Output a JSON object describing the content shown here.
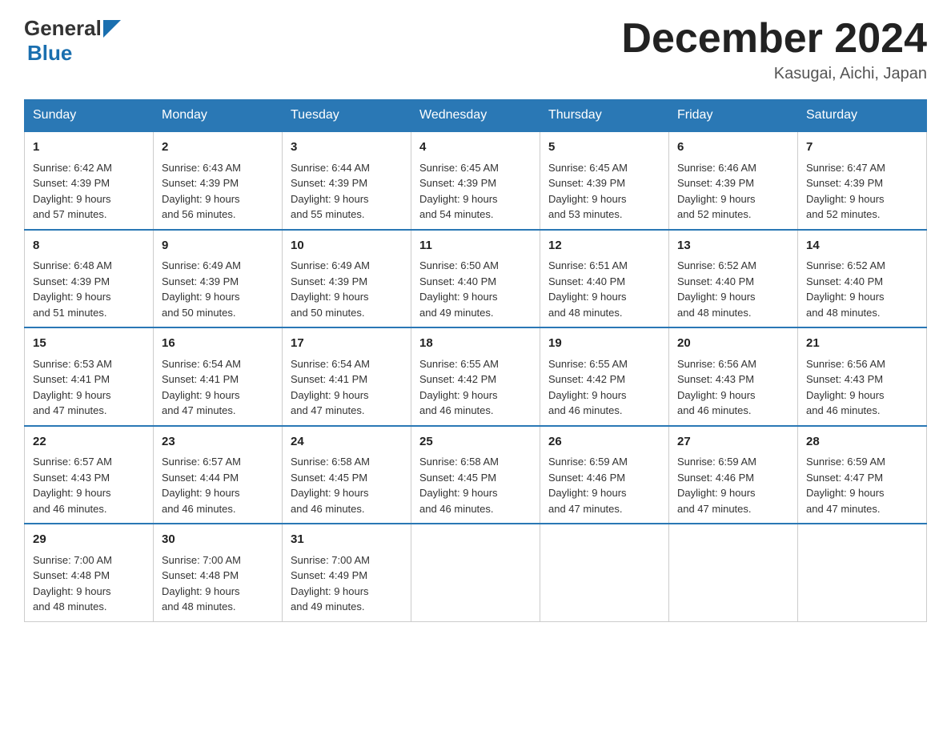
{
  "header": {
    "logo_general": "General",
    "logo_blue": "Blue",
    "month_title": "December 2024",
    "subtitle": "Kasugai, Aichi, Japan"
  },
  "days_of_week": [
    "Sunday",
    "Monday",
    "Tuesday",
    "Wednesday",
    "Thursday",
    "Friday",
    "Saturday"
  ],
  "weeks": [
    [
      {
        "day": "1",
        "sunrise": "6:42 AM",
        "sunset": "4:39 PM",
        "daylight": "9 hours and 57 minutes."
      },
      {
        "day": "2",
        "sunrise": "6:43 AM",
        "sunset": "4:39 PM",
        "daylight": "9 hours and 56 minutes."
      },
      {
        "day": "3",
        "sunrise": "6:44 AM",
        "sunset": "4:39 PM",
        "daylight": "9 hours and 55 minutes."
      },
      {
        "day": "4",
        "sunrise": "6:45 AM",
        "sunset": "4:39 PM",
        "daylight": "9 hours and 54 minutes."
      },
      {
        "day": "5",
        "sunrise": "6:45 AM",
        "sunset": "4:39 PM",
        "daylight": "9 hours and 53 minutes."
      },
      {
        "day": "6",
        "sunrise": "6:46 AM",
        "sunset": "4:39 PM",
        "daylight": "9 hours and 52 minutes."
      },
      {
        "day": "7",
        "sunrise": "6:47 AM",
        "sunset": "4:39 PM",
        "daylight": "9 hours and 52 minutes."
      }
    ],
    [
      {
        "day": "8",
        "sunrise": "6:48 AM",
        "sunset": "4:39 PM",
        "daylight": "9 hours and 51 minutes."
      },
      {
        "day": "9",
        "sunrise": "6:49 AM",
        "sunset": "4:39 PM",
        "daylight": "9 hours and 50 minutes."
      },
      {
        "day": "10",
        "sunrise": "6:49 AM",
        "sunset": "4:39 PM",
        "daylight": "9 hours and 50 minutes."
      },
      {
        "day": "11",
        "sunrise": "6:50 AM",
        "sunset": "4:40 PM",
        "daylight": "9 hours and 49 minutes."
      },
      {
        "day": "12",
        "sunrise": "6:51 AM",
        "sunset": "4:40 PM",
        "daylight": "9 hours and 48 minutes."
      },
      {
        "day": "13",
        "sunrise": "6:52 AM",
        "sunset": "4:40 PM",
        "daylight": "9 hours and 48 minutes."
      },
      {
        "day": "14",
        "sunrise": "6:52 AM",
        "sunset": "4:40 PM",
        "daylight": "9 hours and 48 minutes."
      }
    ],
    [
      {
        "day": "15",
        "sunrise": "6:53 AM",
        "sunset": "4:41 PM",
        "daylight": "9 hours and 47 minutes."
      },
      {
        "day": "16",
        "sunrise": "6:54 AM",
        "sunset": "4:41 PM",
        "daylight": "9 hours and 47 minutes."
      },
      {
        "day": "17",
        "sunrise": "6:54 AM",
        "sunset": "4:41 PM",
        "daylight": "9 hours and 47 minutes."
      },
      {
        "day": "18",
        "sunrise": "6:55 AM",
        "sunset": "4:42 PM",
        "daylight": "9 hours and 46 minutes."
      },
      {
        "day": "19",
        "sunrise": "6:55 AM",
        "sunset": "4:42 PM",
        "daylight": "9 hours and 46 minutes."
      },
      {
        "day": "20",
        "sunrise": "6:56 AM",
        "sunset": "4:43 PM",
        "daylight": "9 hours and 46 minutes."
      },
      {
        "day": "21",
        "sunrise": "6:56 AM",
        "sunset": "4:43 PM",
        "daylight": "9 hours and 46 minutes."
      }
    ],
    [
      {
        "day": "22",
        "sunrise": "6:57 AM",
        "sunset": "4:43 PM",
        "daylight": "9 hours and 46 minutes."
      },
      {
        "day": "23",
        "sunrise": "6:57 AM",
        "sunset": "4:44 PM",
        "daylight": "9 hours and 46 minutes."
      },
      {
        "day": "24",
        "sunrise": "6:58 AM",
        "sunset": "4:45 PM",
        "daylight": "9 hours and 46 minutes."
      },
      {
        "day": "25",
        "sunrise": "6:58 AM",
        "sunset": "4:45 PM",
        "daylight": "9 hours and 46 minutes."
      },
      {
        "day": "26",
        "sunrise": "6:59 AM",
        "sunset": "4:46 PM",
        "daylight": "9 hours and 47 minutes."
      },
      {
        "day": "27",
        "sunrise": "6:59 AM",
        "sunset": "4:46 PM",
        "daylight": "9 hours and 47 minutes."
      },
      {
        "day": "28",
        "sunrise": "6:59 AM",
        "sunset": "4:47 PM",
        "daylight": "9 hours and 47 minutes."
      }
    ],
    [
      {
        "day": "29",
        "sunrise": "7:00 AM",
        "sunset": "4:48 PM",
        "daylight": "9 hours and 48 minutes."
      },
      {
        "day": "30",
        "sunrise": "7:00 AM",
        "sunset": "4:48 PM",
        "daylight": "9 hours and 48 minutes."
      },
      {
        "day": "31",
        "sunrise": "7:00 AM",
        "sunset": "4:49 PM",
        "daylight": "9 hours and 49 minutes."
      },
      null,
      null,
      null,
      null
    ]
  ],
  "labels": {
    "sunrise": "Sunrise:",
    "sunset": "Sunset:",
    "daylight": "Daylight:"
  }
}
